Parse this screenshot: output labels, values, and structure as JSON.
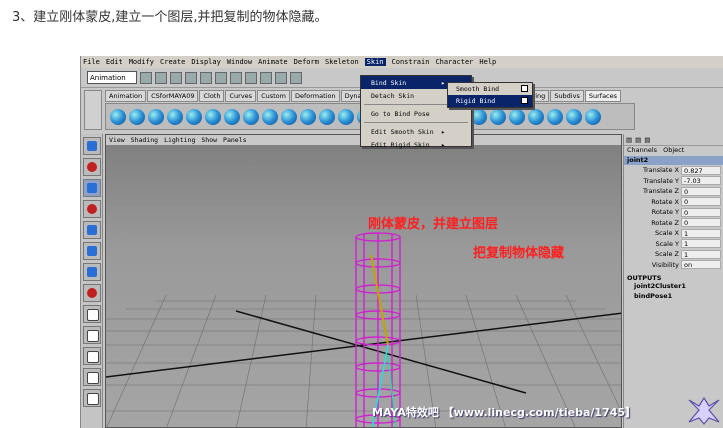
{
  "caption": "3、建立刚体蒙皮,建立一个图层,并把复制的物体隐藏。",
  "menubar": {
    "items": [
      "File",
      "Edit",
      "Modify",
      "Create",
      "Display",
      "Window",
      "Animate",
      "Deform",
      "Skeleton",
      "Skin",
      "Constrain",
      "Character",
      "Help"
    ]
  },
  "status": {
    "mode": "Animation"
  },
  "shelf_tabs": [
    "Animation",
    "CSforMAYA09",
    "Cloth",
    "Curves",
    "Custom",
    "Deformation",
    "Dynamics",
    "ons",
    "Rendering",
    "Subdivs",
    "Surfaces"
  ],
  "skin_menu": {
    "items": [
      "Bind Skin",
      "Detach Skin",
      "Go to Bind Pose",
      "Edit Smooth Skin",
      "Edit Rigid Skin"
    ],
    "arrow": "▸"
  },
  "bind_submenu": [
    "Smooth Bind",
    "Rigid Bind"
  ],
  "viewport": {
    "menu": [
      "View",
      "Shading",
      "Lighting",
      "Show",
      "Panels"
    ],
    "annotation_line1": "刚体蒙皮，并建立图层",
    "annotation_line2": "把复制物体隐藏"
  },
  "channel_box": {
    "tabs": [
      "Channels",
      "Object"
    ],
    "node": "joint2",
    "attributes": [
      {
        "name": "Translate X",
        "value": "0.827"
      },
      {
        "name": "Translate Y",
        "value": "-7.03"
      },
      {
        "name": "Translate Z",
        "value": "0"
      },
      {
        "name": "Rotate X",
        "value": "0"
      },
      {
        "name": "Rotate Y",
        "value": "0"
      },
      {
        "name": "Rotate Z",
        "value": "0"
      },
      {
        "name": "Scale X",
        "value": "1"
      },
      {
        "name": "Scale Y",
        "value": "1"
      },
      {
        "name": "Scale Z",
        "value": "1"
      },
      {
        "name": "Visibility",
        "value": "on"
      }
    ],
    "outputs_label": "OUTPUTS",
    "outputs": [
      "joint2Cluster1",
      "bindPose1"
    ]
  },
  "watermark": "MAYA特效吧 【www.linecg.com/tieba/1745】",
  "colors": {
    "annotation": "#ff2020",
    "highlight": "#0a246a",
    "cage": "#d020d0"
  }
}
